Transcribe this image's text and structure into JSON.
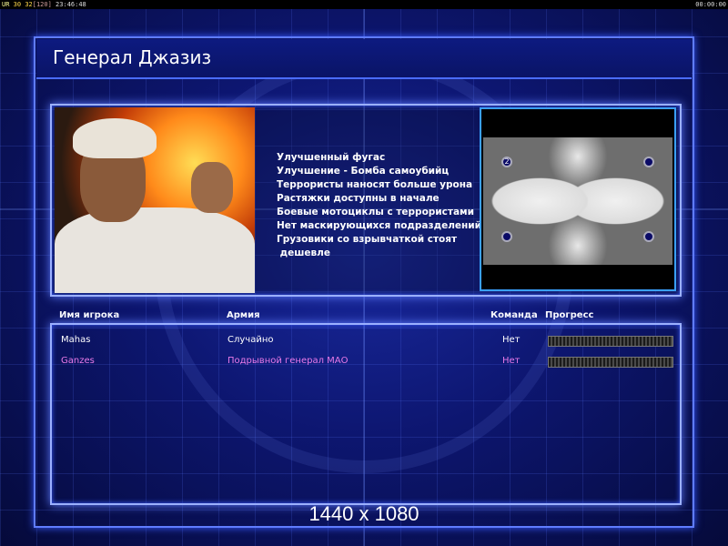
{
  "topbar": {
    "stat_a": "UR",
    "stat_b": "30",
    "stat_c": "32",
    "stat_d": "[120]",
    "time": "23:46:48",
    "timer": "00:00:00"
  },
  "title": "Генерал Джазиз",
  "description": [
    "Улучшенный фугас",
    "Улучшение - Бомба самоубийц",
    "Террористы наносят больше урона",
    "Растяжки доступны в начале",
    "Боевые мотоциклы с террористами",
    "Нет маскирующихся подразделений",
    "Грузовики со взрывчаткой стоят",
    " дешевле"
  ],
  "minimap": {
    "start_label": "2"
  },
  "columns": {
    "player": "Имя игрока",
    "army": "Армия",
    "team": "Команда",
    "progress": "Прогресс"
  },
  "players": [
    {
      "name": "Mahas",
      "army": "Случайно",
      "team": "Нет",
      "color": "#ffffff"
    },
    {
      "name": "Ganzes",
      "army": "Подрывной генерал МАО",
      "team": "Нет",
      "color": "#e87ae8"
    }
  ],
  "resolution_caption": "1440 x 1080",
  "colors": {
    "accent": "#5f7cff",
    "frame": "#9bb0ff"
  }
}
